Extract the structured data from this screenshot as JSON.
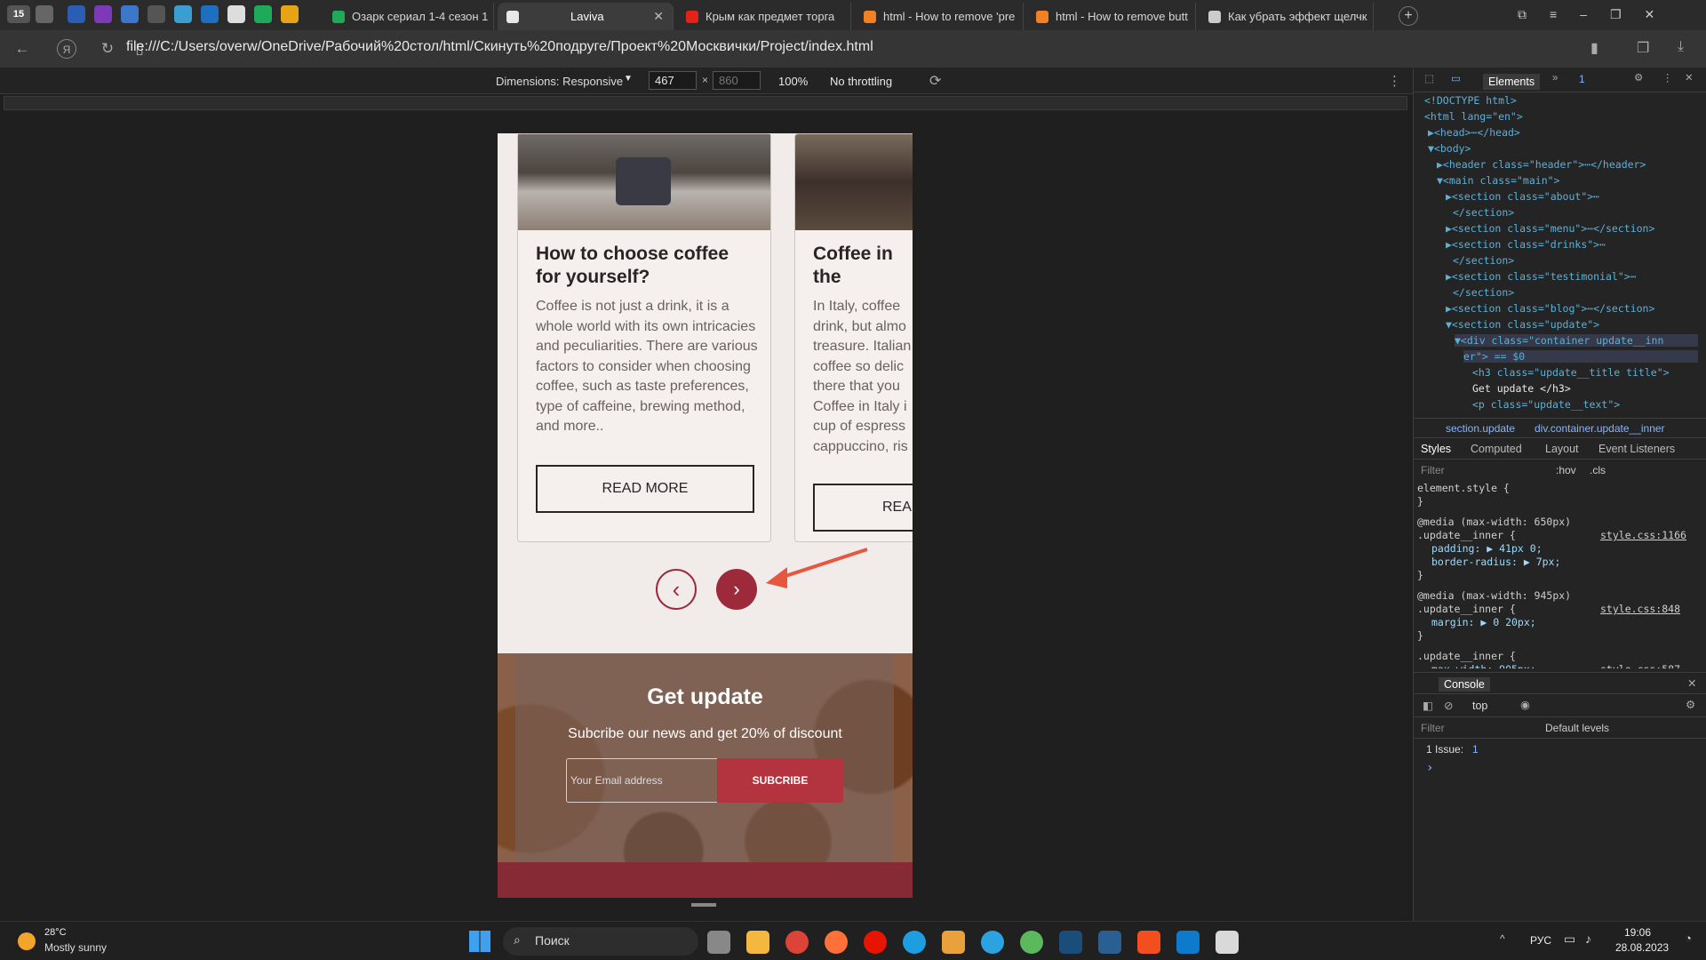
{
  "tabs": [
    {
      "label": "Озарк сериал 1-4 сезон 1",
      "color": "#1faa59"
    },
    {
      "label": "Laviva",
      "color": "#e8e8e8",
      "active": true
    },
    {
      "label": "Крым как предмет торга",
      "color": "#e62117"
    },
    {
      "label": "html - How to remove 'pre",
      "color": "#f48024"
    },
    {
      "label": "html - How to remove butt",
      "color": "#f48024"
    },
    {
      "label": "Как убрать эффект щелчк",
      "color": "#cccccc"
    }
  ],
  "pinned_count": "15",
  "url": "file:///C:/Users/overw/OneDrive/Рабочий%20стол/html/Скинуть%20подруге/Проект%20Москвички/Project/index.html",
  "devicebar": {
    "dimensions_label": "Dimensions: Responsive",
    "width": "467",
    "height": "860",
    "zoom": "100%",
    "throttling": "No throttling"
  },
  "page": {
    "card1": {
      "title": "How to choose coffee for yourself?",
      "text": "Coffee is not just a drink, it is a whole world with its own intricacies and peculiarities. There are various factors to consider when choosing coffee, such as taste preferences, type of caffeine, brewing method, and more..",
      "button": "READ MORE"
    },
    "card2": {
      "title": "Coffee in the different co",
      "text": "In Italy, coffee drink, but almo treasure. Italian coffee so delic there that you Coffee in Italy i cup of espress cappuccino, ris macchiato, etc",
      "button": "READ"
    },
    "prev_arrow": "‹",
    "next_arrow": "›",
    "update": {
      "title": "Get update",
      "text": "Subcribe our news and get 20% of discount",
      "placeholder": "Your Email address",
      "button": "SUBCRIBE"
    }
  },
  "devtools": {
    "tabs": {
      "elements": "Elements",
      "issues_count": "1"
    },
    "dom": [
      "<!DOCTYPE html>",
      "<html lang=\"en\">",
      "▶<head>⋯</head>",
      "▼<body>",
      "▶<header class=\"header\">⋯</header>",
      "▼<main class=\"main\">",
      "▶<section class=\"about\">⋯",
      "</section>",
      "▶<section class=\"menu\">⋯</section>",
      "▶<section class=\"drinks\">⋯",
      "</section>",
      "▶<section class=\"testimonial\">⋯",
      "</section>",
      "▶<section class=\"blog\">⋯</section>",
      "▼<section class=\"update\">",
      "▼<div class=\"container update__inn",
      "er\"> == $0",
      "<h3 class=\"update__title title\">",
      "Get update </h3>",
      "<p class=\"update__text\">"
    ],
    "breadcrumb": [
      "section.update",
      "div.container.update__inner"
    ],
    "style_tabs": [
      "Styles",
      "Computed",
      "Layout",
      "Event Listeners"
    ],
    "filter_placeholder": "Filter",
    "hov": ":hov",
    "cls": ".cls",
    "rules": [
      {
        "header": "element.style {",
        "lines": [
          "}"
        ],
        "source": ""
      },
      {
        "header": "@media (max-width: 650px)",
        "lines": [
          ".update__inner {",
          "padding: ▶ 41px 0;",
          "border-radius: ▶ 7px;",
          "}"
        ],
        "source": "style.css:1166"
      },
      {
        "header": "@media (max-width: 945px)",
        "lines": [
          ".update__inner {",
          "margin: ▶ 0 20px;",
          "}"
        ],
        "source": "style.css:848"
      },
      {
        "header": ".update__inner {",
        "lines": [
          "max-width: 905px;",
          "margin: ▶ 0 auto;",
          "padding: ▶ 50px 0;"
        ],
        "source": "style.css:587"
      }
    ],
    "console": {
      "title": "Console",
      "context": "top",
      "filter": "Filter",
      "levels": "Default levels",
      "issues": "1 Issue:",
      "issues_count": "1",
      "prompt": "›"
    }
  },
  "taskbar": {
    "temp": "28°C",
    "weather": "Mostly sunny",
    "search": "Поиск",
    "lang": "РУС",
    "time": "19:06",
    "date": "28.08.2023"
  }
}
